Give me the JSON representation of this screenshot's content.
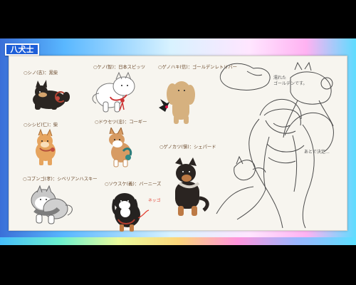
{
  "title": "八犬士",
  "labels": {
    "shiba_black": "○シノ(志)：黒柴",
    "samoyed": "○ケノ(智)：日本スピッツ",
    "golden": "○ゲノハキ(信)：ゴールデンレトリバー",
    "shiba_red": "○シシビ(仁)：柴",
    "corgi": "○ドウセツ(忠)：コーギー",
    "shepherd": "○ゲノカツ(悌)：シェパード",
    "malamute": "○コブンゴ(孝)：シベリアンハスキー",
    "bernese": "○ソウスケ(義)：バーニーズ"
  },
  "notes": {
    "top_right": "濡れた\nゴールデンです。",
    "right_small": "あとで決定…",
    "bernese_accent": "ネッゴ"
  },
  "colors": {
    "frame_blue": "#1d5ed8",
    "paper": "#f7f5ef",
    "ink": "#5c4a3d"
  }
}
